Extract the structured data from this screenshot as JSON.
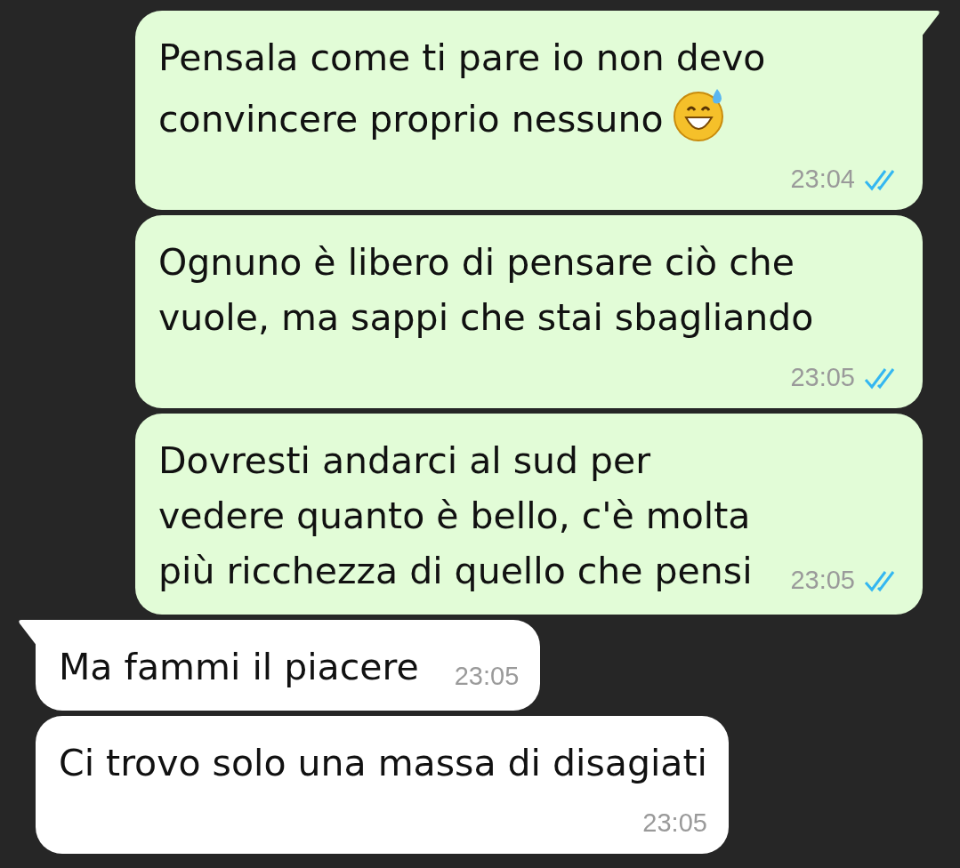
{
  "messages": [
    {
      "kind": "sent",
      "text": "Pensala come ti pare io non devo convincere proprio nessuno",
      "emoji": true,
      "time": "23:04",
      "read": true,
      "tail": true
    },
    {
      "kind": "sent",
      "text": "Ognuno è libero di pensare ciò che vuole, ma sappi che stai sbagliando",
      "emoji": false,
      "time": "23:05",
      "read": true,
      "tail": false
    },
    {
      "kind": "sent-compact",
      "text": "Dovresti andarci al sud per vedere quanto è bello, c'è molta più ricchezza di quello che pensi",
      "emoji": false,
      "time": "23:05",
      "read": true,
      "tail": false
    },
    {
      "kind": "received-compact",
      "text": "Ma fammi il piacere",
      "emoji": false,
      "time": "23:05",
      "tail": true
    },
    {
      "kind": "received",
      "text": "Ci trovo solo una massa di disagiati",
      "emoji": false,
      "time": "23:05",
      "tail": false
    }
  ]
}
